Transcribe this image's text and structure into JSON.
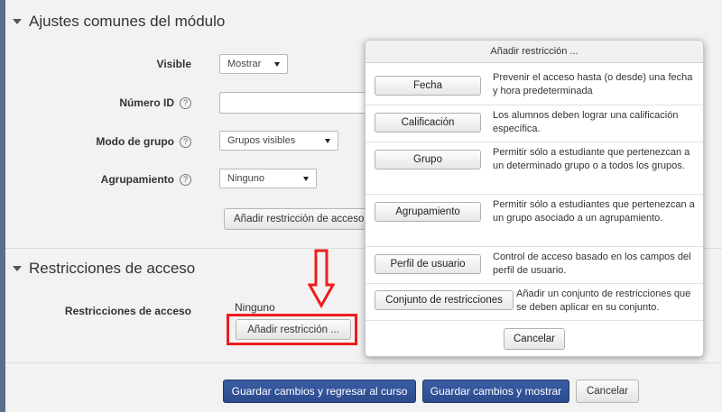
{
  "module_settings": {
    "heading": "Ajustes comunes del módulo",
    "visible": {
      "label": "Visible",
      "value": "Mostrar"
    },
    "id_number": {
      "label": "Número ID",
      "value": ""
    },
    "group_mode": {
      "label": "Modo de grupo",
      "value": "Grupos visibles"
    },
    "grouping": {
      "label": "Agrupamiento",
      "value": "Ninguno"
    },
    "add_access_restriction_button": "Añadir restricción de acceso"
  },
  "access_restrictions": {
    "heading": "Restricciones de acceso",
    "label": "Restricciones de acceso",
    "value": "Ninguno",
    "add_restriction_button": "Añadir restricción ..."
  },
  "footer": {
    "save_return": "Guardar cambios y regresar al curso",
    "save_show": "Guardar cambios y mostrar",
    "cancel": "Cancelar"
  },
  "modal": {
    "title": "Añadir restricción ...",
    "options": [
      {
        "button": "Fecha",
        "description": "Prevenir el acceso hasta (o desde) una fecha y hora predeterminada"
      },
      {
        "button": "Calificación",
        "description": "Los alumnos deben lograr una calificación específica."
      },
      {
        "button": "Grupo",
        "description": "Permitir sólo a estudiante que pertenezcan a un determinado grupo o a todos los grupos."
      },
      {
        "button": "Agrupamiento",
        "description": "Permitir sólo a estudiantes que pertenezcan a un grupo asociado a un agrupamiento."
      },
      {
        "button": "Perfil de usuario",
        "description": "Control de acceso basado en los campos del perfil de usuario."
      },
      {
        "button": "Conjunto de restricciones",
        "description": "Añadir un conjunto de restricciones que se deben aplicar en su conjunto."
      }
    ],
    "cancel": "Cancelar"
  },
  "colors": {
    "primary": "#2c4b8d",
    "highlight": "#ee1c1c",
    "frame": "#5a6f8c"
  }
}
